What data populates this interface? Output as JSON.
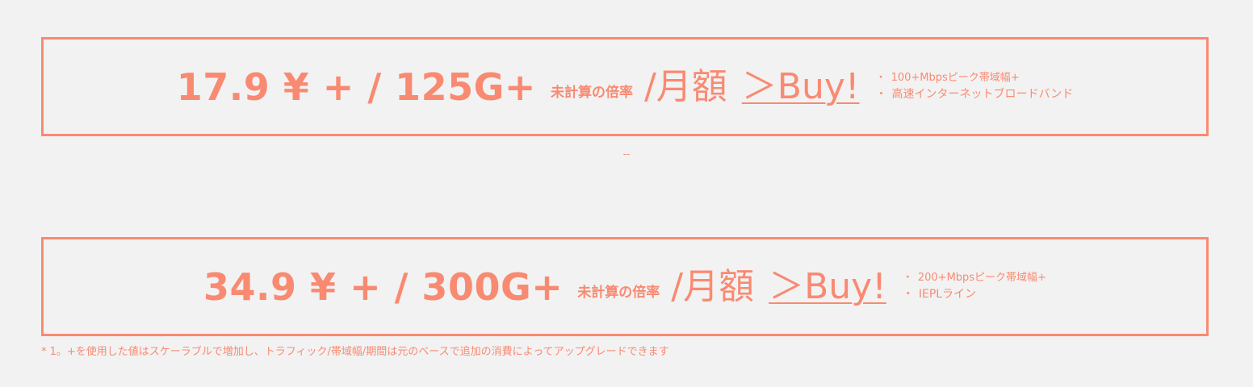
{
  "plans": [
    {
      "price": "17.9 ¥ + / 125G+",
      "rate_note": "未計算の倍率",
      "period": "/月額",
      "buy_label": "＞Buy!",
      "features": [
        "100+Mbpsピーク帯域幅+",
        "高速インターネットブロードバンド"
      ]
    },
    {
      "price": "34.9 ¥ + / 300G+",
      "rate_note": "未計算の倍率",
      "period": "/月額",
      "buy_label": "＞Buy!",
      "features": [
        "200+Mbpsピーク帯域幅+",
        "IEPLライン"
      ]
    }
  ],
  "bullet": "・",
  "separator": "--",
  "footnote": "* 1。+を使用した値はスケーラブルで増加し、トラフィック/帯域幅/期間は元のベースで追加の消費によってアップグレードできます",
  "colors": {
    "accent": "#f98a72",
    "background": "#f2f2f2"
  }
}
